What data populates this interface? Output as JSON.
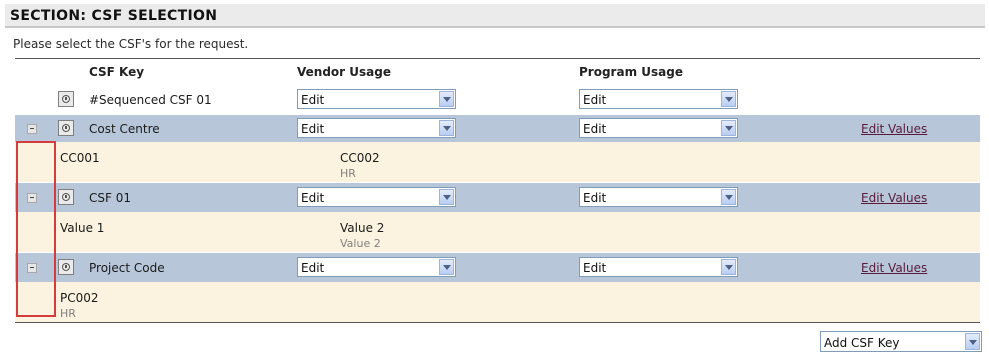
{
  "section": {
    "title": "SECTION: CSF SELECTION",
    "instructions": "Please select the CSF's for the request."
  },
  "columns": {
    "csf_key": "CSF Key",
    "vendor_usage": "Vendor Usage",
    "program_usage": "Program Usage"
  },
  "rows": [
    {
      "key": "#Sequenced CSF 01",
      "vendor_usage": "Edit",
      "program_usage": "Edit",
      "expanded": false,
      "toggle_icon": "minus-icon",
      "icon": "calculator-icon"
    },
    {
      "key": "Cost Centre",
      "vendor_usage": "Edit",
      "program_usage": "Edit",
      "edit_link": "Edit Values",
      "toggle_icon": "minus-icon",
      "icon": "calculator-icon",
      "values": [
        {
          "primary": "CC001",
          "secondary": ""
        },
        {
          "primary": "CC002",
          "secondary": "HR"
        }
      ]
    },
    {
      "key": "CSF 01",
      "vendor_usage": "Edit",
      "program_usage": "Edit",
      "edit_link": "Edit Values",
      "toggle_icon": "minus-icon",
      "icon": "calculator-icon",
      "values": [
        {
          "primary": "Value 1",
          "secondary": ""
        },
        {
          "primary": "Value 2",
          "secondary": "Value 2"
        }
      ]
    },
    {
      "key": "Project Code",
      "vendor_usage": "Edit",
      "program_usage": "Edit",
      "edit_link": "Edit Values",
      "toggle_icon": "minus-icon",
      "icon": "calculator-icon",
      "values": [
        {
          "primary": "PC002",
          "secondary": "HR"
        }
      ]
    }
  ],
  "add_csf": {
    "selected": "Add CSF Key"
  },
  "colors": {
    "row_header_bg": "#b7c7d9",
    "values_bg": "#fbf3df",
    "link": "#5a1a3a",
    "highlight_frame": "#d23c3c"
  }
}
